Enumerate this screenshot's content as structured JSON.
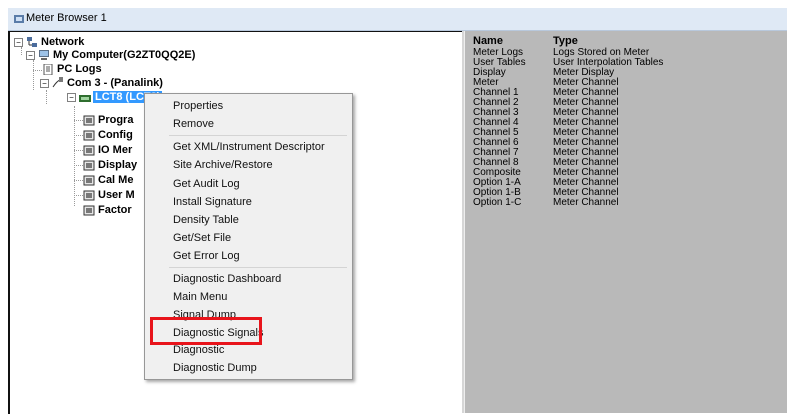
{
  "window": {
    "title": "Meter Browser 1"
  },
  "tree": {
    "network": "Network",
    "computer": "My Computer(G2ZT0QQ2E)",
    "pc_logs": "PC Logs",
    "com": "Com 3 -  (Panalink)",
    "device": "LCT8 (LCT8)",
    "children": [
      "Progra",
      "Config",
      "IO Mer",
      "Display",
      "Cal Me",
      "User M",
      "Factor"
    ]
  },
  "list": {
    "headers": {
      "name": "Name",
      "type": "Type"
    },
    "rows": [
      {
        "name": "Meter Logs",
        "type": "Logs Stored on Meter"
      },
      {
        "name": "User Tables",
        "type": "User Interpolation Tables"
      },
      {
        "name": "Display",
        "type": "Meter Display"
      },
      {
        "name": "Meter",
        "type": "Meter Channel"
      },
      {
        "name": "Channel 1",
        "type": "Meter Channel"
      },
      {
        "name": "Channel 2",
        "type": "Meter Channel"
      },
      {
        "name": "Channel 3",
        "type": "Meter Channel"
      },
      {
        "name": "Channel 4",
        "type": "Meter Channel"
      },
      {
        "name": "Channel 5",
        "type": "Meter Channel"
      },
      {
        "name": "Channel 6",
        "type": "Meter Channel"
      },
      {
        "name": "Channel 7",
        "type": "Meter Channel"
      },
      {
        "name": "Channel 8",
        "type": "Meter Channel"
      },
      {
        "name": "Composite",
        "type": "Meter Channel"
      },
      {
        "name": "Option 1-A",
        "type": "Meter Channel"
      },
      {
        "name": "Option 1-B",
        "type": "Meter Channel"
      },
      {
        "name": "Option 1-C",
        "type": "Meter Channel"
      }
    ]
  },
  "context_menu": {
    "items": [
      "Properties",
      "Remove",
      "Get XML/Instrument Descriptor",
      "Site Archive/Restore",
      "Get Audit Log",
      "Install Signature",
      "Density Table",
      "Get/Set File",
      "Get Error Log",
      "Diagnostic Dashboard",
      "Main Menu",
      "Signal Dump",
      "Diagnostic Signals",
      "Diagnostic",
      "Diagnostic Dump"
    ]
  },
  "colors": {
    "highlight_box": "#e8141b",
    "selection": "#3399ff",
    "list_background": "#b9b9b9"
  }
}
